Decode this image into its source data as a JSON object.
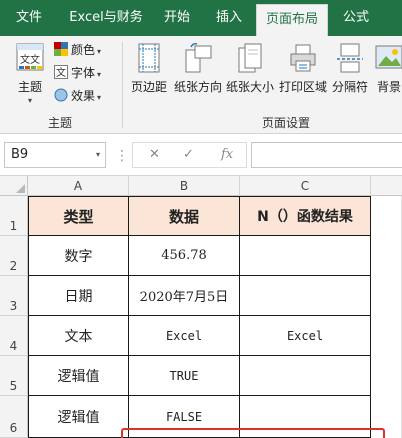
{
  "ribbon_tabs": [
    {
      "label": "文件"
    },
    {
      "label": "Excel与财务"
    },
    {
      "label": "开始"
    },
    {
      "label": "插入"
    },
    {
      "label": "页面布局",
      "active": true
    },
    {
      "label": "公式"
    }
  ],
  "ribbon": {
    "themes_group": {
      "themes_label": "主题",
      "colors_label": "颜色",
      "fonts_label": "字体",
      "effects_label": "效果",
      "group_label": "主题"
    },
    "page_setup_group": {
      "margins_label": "页边距",
      "orientation_label": "纸张方向",
      "size_label": "纸张大小",
      "print_area_label": "打印区域",
      "breaks_label": "分隔符",
      "background_label": "背景",
      "group_label": "页面设置"
    }
  },
  "formula_bar": {
    "name_box": "B9",
    "fx_label": "fx",
    "value": ""
  },
  "grid": {
    "columns": [
      "A",
      "B",
      "C"
    ],
    "rows": [
      {
        "num": "1",
        "cells": [
          "类型",
          "数据",
          "N（）函数结果"
        ]
      },
      {
        "num": "2",
        "cells": [
          "数字",
          "456.78",
          ""
        ]
      },
      {
        "num": "3",
        "cells": [
          "日期",
          "2020年7月5日",
          ""
        ]
      },
      {
        "num": "4",
        "cells": [
          "文本",
          "Excel",
          "Excel"
        ]
      },
      {
        "num": "5",
        "cells": [
          "逻辑值",
          "TRUE",
          ""
        ]
      },
      {
        "num": "6",
        "cells": [
          "逻辑值",
          "FALSE",
          ""
        ]
      }
    ]
  },
  "colors": {
    "ribbon_green": "#217346",
    "header_fill": "#fbe5d6",
    "highlight_red": "#d9342b"
  }
}
